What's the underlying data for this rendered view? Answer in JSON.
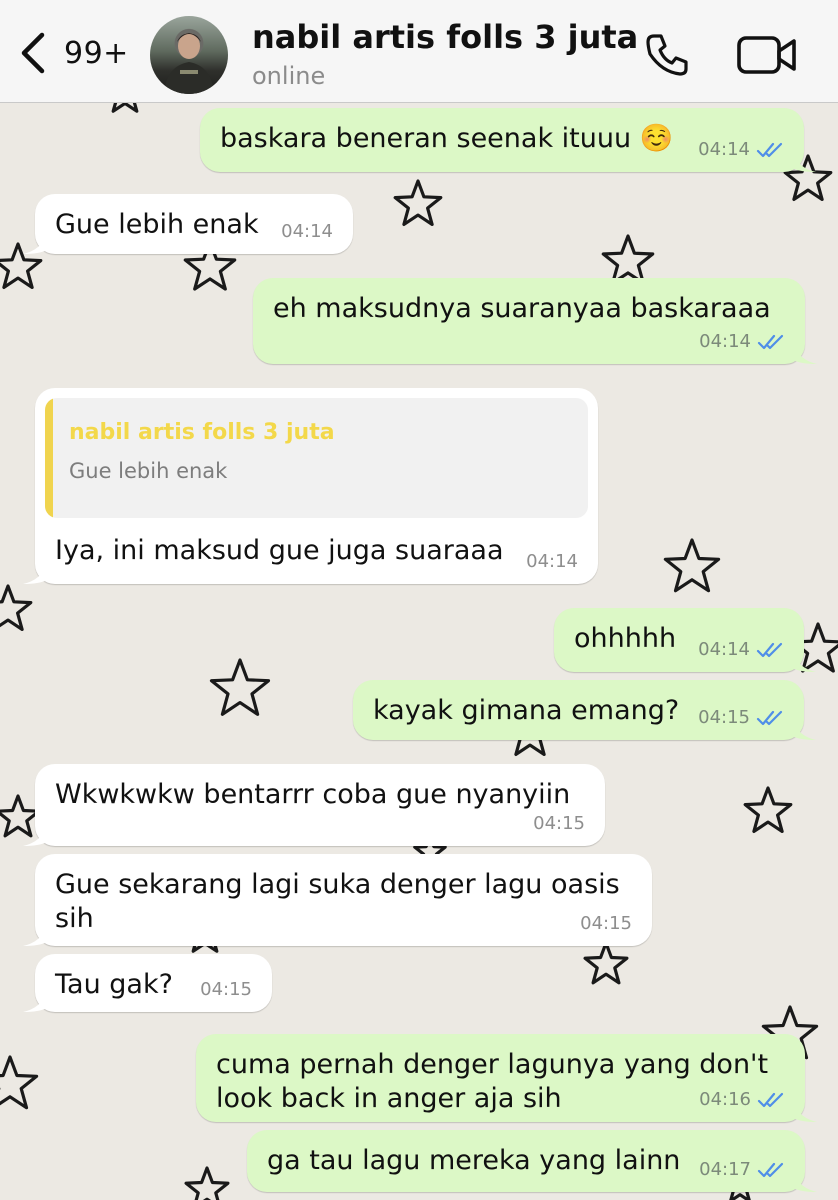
{
  "header": {
    "unread_count": "99+",
    "contact_name": "nabil artis folls 3 juta",
    "status": "online"
  },
  "icons": {
    "back": "chevron-left-icon",
    "call": "phone-icon",
    "video": "video-camera-icon",
    "read_receipt": "double-check-icon"
  },
  "colors": {
    "outgoing_bubble": "#dcf8c6",
    "incoming_bubble": "#ffffff",
    "read_tick": "#4f8ee8",
    "quote_accent": "#f0d44e"
  },
  "messages": [
    {
      "dir": "out",
      "text": "baskara beneran seenak ituuu ☺️",
      "time": "04:14",
      "read": true
    },
    {
      "dir": "in",
      "text": "Gue lebih enak",
      "time": "04:14"
    },
    {
      "dir": "out",
      "text": "eh maksudnya suaranyaa baskaraaa",
      "time": "04:14",
      "read": true
    },
    {
      "dir": "in",
      "text": "Iya, ini maksud gue juga suaraaa",
      "time": "04:14",
      "quote": {
        "name": "nabil artis folls 3 juta",
        "text": "Gue lebih enak"
      }
    },
    {
      "dir": "out",
      "text": "ohhhhh",
      "time": "04:14",
      "read": true
    },
    {
      "dir": "out",
      "text": "kayak gimana emang?",
      "time": "04:15",
      "read": true
    },
    {
      "dir": "in",
      "text": "Wkwkwkw bentarrr coba gue nyanyiin",
      "time": "04:15"
    },
    {
      "dir": "in",
      "text": "Gue sekarang lagi suka denger lagu oasis\nsih",
      "time": "04:15"
    },
    {
      "dir": "in",
      "text": "Tau gak?",
      "time": "04:15"
    },
    {
      "dir": "out",
      "text": "cuma pernah denger lagunya yang don't\nlook back in anger aja sih",
      "time": "04:16",
      "read": true
    },
    {
      "dir": "out",
      "text": "ga tau lagu mereka yang lainn",
      "time": "04:17",
      "read": true
    }
  ]
}
